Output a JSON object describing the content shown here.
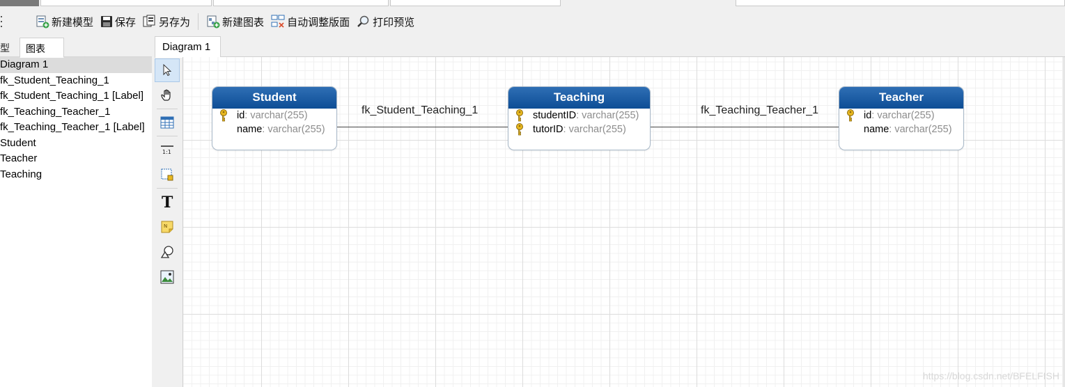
{
  "toolbar": {
    "new_model": "新建模型",
    "save": "保存",
    "save_as": "另存为",
    "new_diagram": "新建图表",
    "auto_layout": "自动调整版面",
    "print_preview": "打印预览"
  },
  "left_panel": {
    "tab_model": "型",
    "tab_diagram": "图表",
    "items": [
      "Diagram 1",
      "fk_Student_Teaching_1",
      "fk_Student_Teaching_1 [Label]",
      "fk_Teaching_Teacher_1",
      "fk_Teaching_Teacher_1 [Label]",
      "Student",
      "Teacher",
      "Teaching"
    ],
    "selected_index": 0
  },
  "diagram_tab": {
    "label": "Diagram 1"
  },
  "entities": {
    "student": {
      "name": "Student",
      "fields": [
        {
          "name": "id",
          "type": ": varchar(255)",
          "key": true
        },
        {
          "name": "name",
          "type": ": varchar(255)",
          "key": false
        }
      ]
    },
    "teaching": {
      "name": "Teaching",
      "fields": [
        {
          "name": "studentID",
          "type": ": varchar(255)",
          "key": true
        },
        {
          "name": "tutorID",
          "type": ": varchar(255)",
          "key": true
        }
      ]
    },
    "teacher": {
      "name": "Teacher",
      "fields": [
        {
          "name": "id",
          "type": ": varchar(255)",
          "key": true
        },
        {
          "name": "name",
          "type": ": varchar(255)",
          "key": false
        }
      ]
    }
  },
  "relations": {
    "fk1": "fk_Student_Teaching_1",
    "fk2": "fk_Teaching_Teacher_1"
  },
  "watermark": "https://blog.csdn.net/BFELFISH",
  "colors": {
    "entity_header": "#0d4d95",
    "selection": "#dcdcdc",
    "palette_active": "#d5e6f7",
    "key_icon": "#e8b820"
  }
}
